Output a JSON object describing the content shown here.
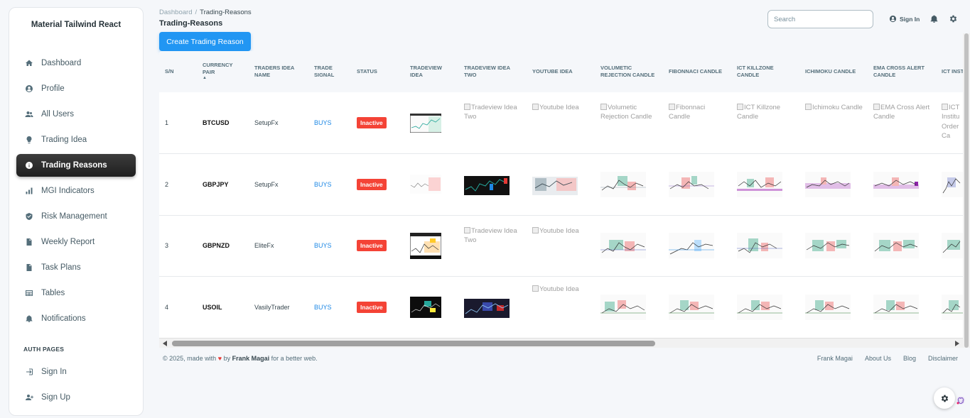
{
  "brand": "Material Tailwind React",
  "sidebar": {
    "items": [
      {
        "label": "Dashboard",
        "icon": "home-icon"
      },
      {
        "label": "Profile",
        "icon": "user-circle-icon"
      },
      {
        "label": "All Users",
        "icon": "users-icon"
      },
      {
        "label": "Trading Idea",
        "icon": "lightbulb-icon"
      },
      {
        "label": "Trading Reasons",
        "icon": "info-icon",
        "active": true
      },
      {
        "label": "MGI Indicators",
        "icon": "bar-chart-icon"
      },
      {
        "label": "Risk Management",
        "icon": "shield-icon"
      },
      {
        "label": "Weekly Report",
        "icon": "document-icon"
      },
      {
        "label": "Task Plans",
        "icon": "document-icon"
      },
      {
        "label": "Tables",
        "icon": "table-icon"
      },
      {
        "label": "Notifications",
        "icon": "bell-icon"
      }
    ],
    "auth_title": "AUTH PAGES",
    "auth_items": [
      {
        "label": "Sign In",
        "icon": "sign-in-icon"
      },
      {
        "label": "Sign Up",
        "icon": "user-plus-icon"
      }
    ]
  },
  "header": {
    "breadcrumb": {
      "root": "Dashboard",
      "sep": "/",
      "current": "Trading-Reasons"
    },
    "title": "Trading-Reasons",
    "search_placeholder": "Search",
    "signin_label": "Sign In"
  },
  "create_button": "Create Trading Reason",
  "table": {
    "headers": {
      "sn": "S/N",
      "pair": "Currency Pair",
      "trader": "Traders Idea Name",
      "signal": "Trade Signal",
      "status": "Status",
      "tv": "Tradeview Idea",
      "tv2": "Tradeview Idea Two",
      "yt": "Youtube Idea",
      "vol": "Volumetic Rejection Candle",
      "fib": "Fibonnaci Candle",
      "ict": "ICT Killzone Candle",
      "ichi": "Ichimoku Candle",
      "ema": "EMA Cross Alert Candle",
      "ictio": "ICT Institu Order Candle"
    },
    "sort_icon": "sort-up-icon",
    "rows": [
      {
        "sn": "1",
        "pair": "BTCUSD",
        "trader": "SetupFx",
        "signal": "BUYS",
        "status": "Inactive",
        "tv2_alt": "Tradeview Idea Two",
        "yt_alt": "Youtube Idea",
        "vol_alt": "Volumetic Rejection Candle",
        "fib_alt": "Fibonnaci Candle",
        "ict_alt": "ICT Killzone Candle",
        "ichi_alt": "Ichimoku Candle",
        "ema_alt": "EMA Cross Alert Candle",
        "ictio_alt": "ICT Institu Order Ca"
      },
      {
        "sn": "2",
        "pair": "GBPJPY",
        "trader": "SetupFx",
        "signal": "BUYS",
        "status": "Inactive"
      },
      {
        "sn": "3",
        "pair": "GBPNZD",
        "trader": "EliteFx",
        "signal": "BUYS",
        "status": "Inactive",
        "tv2_alt": "Tradeview Idea Two",
        "yt_alt": "Youtube Idea"
      },
      {
        "sn": "4",
        "pair": "USOIL",
        "trader": "VasilyTrader",
        "signal": "BUYS",
        "status": "Inactive",
        "yt_alt": "Youtube Idea"
      }
    ]
  },
  "footer": {
    "copyright": "© 2025, made with",
    "heart": "♥",
    "by": "by",
    "author": "Frank Magai",
    "suffix": "for a better web.",
    "links": [
      "Frank Magai",
      "About Us",
      "Blog",
      "Disclaimer"
    ]
  },
  "colors": {
    "accent": "#2196f3",
    "status_inactive": "#f44336",
    "signal": "#1e88e5",
    "active_nav": "#2a2a2a"
  }
}
